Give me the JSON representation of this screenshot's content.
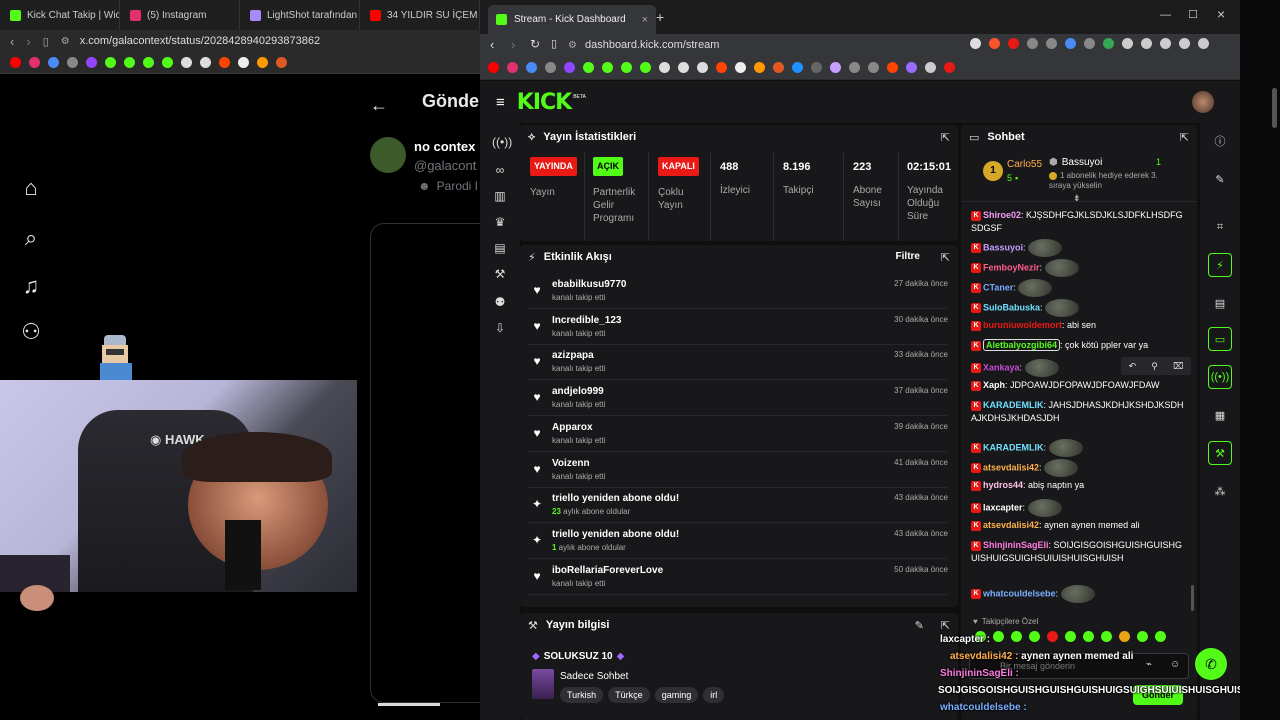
{
  "bg_browser": {
    "tabs": [
      {
        "label": "Kick Chat Takip | Wich",
        "color": "#53fc18"
      },
      {
        "label": "(5) Instagram",
        "color": "#e1306c"
      },
      {
        "label": "LightShot tarafından Ekran",
        "color": "#a78bfa"
      },
      {
        "label": "34 YILDIR SU İÇEM",
        "color": "#ff0000"
      }
    ],
    "url": "x.com/galacontext/status/2028428940293873862",
    "x_page": {
      "title": "Gönde",
      "account_name": "no contex",
      "account_handle": "@galacont",
      "account_type": "Parodi I"
    }
  },
  "browser": {
    "tab_title": "Stream - Kick Dashboard",
    "url": "dashboard.kick.com/stream"
  },
  "kick": {
    "logo": "KICK",
    "logo_badge": "BETA",
    "stats_panel": {
      "title": "Yayın İstatistikleri",
      "items": [
        {
          "badge": "YAYINDA",
          "label": "Yayın",
          "badge_color": "#e91916"
        },
        {
          "badge": "AÇIK",
          "label": "Partnerlik Gelir Programı",
          "badge_color": "#53fc18"
        },
        {
          "badge": "KAPALI",
          "label": "Çoklu Yayın",
          "badge_color": "#e91916"
        },
        {
          "value": "488",
          "label": "İzleyici"
        },
        {
          "value": "8.196",
          "label": "Takipçi"
        },
        {
          "value": "223",
          "label": "Abone Sayısı"
        },
        {
          "value": "02:15:01",
          "label": "Yayında Olduğu Süre"
        }
      ]
    },
    "activity_panel": {
      "title": "Etkinlik Akışı",
      "filter_label": "Filtre",
      "items": [
        {
          "icon": "heart-icon",
          "name": "ebabilkusu9770",
          "sub": "kanalı takip etti",
          "time": "27 dakika önce"
        },
        {
          "icon": "heart-icon",
          "name": "Incredible_123",
          "sub": "kanalı takip etti",
          "time": "30 dakika önce"
        },
        {
          "icon": "heart-icon",
          "name": "azizpapa",
          "sub": "kanalı takip etti",
          "time": "33 dakika önce"
        },
        {
          "icon": "heart-icon",
          "name": "andjelo999",
          "sub": "kanalı takip etti",
          "time": "37 dakika önce"
        },
        {
          "icon": "heart-icon",
          "name": "Apparox",
          "sub": "kanalı takip etti",
          "time": "39 dakika önce"
        },
        {
          "icon": "heart-icon",
          "name": "Voizenn",
          "sub": "kanalı takip etti",
          "time": "41 dakika önce"
        },
        {
          "icon": "sparkle-icon",
          "name": "triello yeniden abone oldu!",
          "sub_num": "23",
          "sub": "aylık abone oldular",
          "time": "43 dakika önce"
        },
        {
          "icon": "sparkle-icon",
          "name": "triello yeniden abone oldu!",
          "sub_num": "1",
          "sub": "aylık abone oldular",
          "time": "43 dakika önce"
        },
        {
          "icon": "heart-icon",
          "name": "iboRellariaForeverLove",
          "sub": "kanalı takip etti",
          "time": "50 dakika önce"
        }
      ]
    },
    "stream_info_panel": {
      "title": "Yayın bilgisi",
      "stream_title": "SOLUKSUZ 10",
      "category": "Sadece Sohbet",
      "tags": [
        "Turkish",
        "Türkçe",
        "gaming",
        "irl"
      ]
    },
    "chat_panel": {
      "title": "Sohbet",
      "pinned_user": "Carlo55",
      "pinned_rank": "1",
      "pinned_count": "5",
      "gifter": "Bassuyoi",
      "gifter_count": "1",
      "gifter_text": "1 abonelik hediye ederek 3. sıraya yükselin",
      "messages": [
        {
          "user": "Shiroe02",
          "color": "#f39cf6",
          "text": "KJŞSDHFGJKLSDJKLSJDFKLHSDFGSDGSF",
          "emote": false
        },
        {
          "user": "Bassuyoi",
          "color": "#c79cff",
          "text": "",
          "emote": true
        },
        {
          "user": "FemboyNezir",
          "color": "#ff5c8a",
          "text": "",
          "emote": true
        },
        {
          "user": "CTaner",
          "color": "#7aa7ff",
          "text": "",
          "emote": true
        },
        {
          "user": "SuloBabuska",
          "color": "#6fe0ff",
          "text": "",
          "emote": true
        },
        {
          "user": "buruniuwoldemort",
          "color": "#e91916",
          "text": "abi sen",
          "emote": false
        },
        {
          "user": "Aletbalyozgibi64",
          "color": "#53fc18",
          "text": "çok kötü ppler var ya",
          "emote": false
        },
        {
          "user": "Xankaya",
          "color": "#c44bd8",
          "text": "",
          "emote": true
        },
        {
          "user": "Xaph",
          "color": "#ffffff",
          "text": "JDPOAWJDFOPAWJDFOAWJFDAW",
          "emote": false
        },
        {
          "user": "KARADEMLIK",
          "color": "#6fe0ff",
          "text": "JAHSJDHASJKDHJKSHDJKSDHAJKDHSJKHDASJDH",
          "emote": false
        },
        {
          "user": "KARADEMLIK",
          "color": "#6fe0ff",
          "text": "",
          "emote": true
        },
        {
          "user": "atsevdalisi42",
          "color": "#ffb04c",
          "text": "",
          "emote": true
        },
        {
          "user": "hydros44",
          "color": "#ffc1e3",
          "text": "abiş naptın ya",
          "emote": false
        },
        {
          "user": "laxcapter",
          "color": "#ffffff",
          "text": "",
          "emote": true
        },
        {
          "user": "atsevdalisi42",
          "color": "#ffb04c",
          "text": "aynen aynen memed ali",
          "emote": false
        },
        {
          "user": "ShinjininSagEli",
          "color": "#ff7be0",
          "text": "SOIJGISGOISHGUISHGUISHGUISHUIGSUIGHSUIUISHUISGHUISH",
          "emote": false
        },
        {
          "user": "whatcouldelsebe",
          "color": "#7ab0ff",
          "text": "",
          "emote": true
        }
      ],
      "followers_only": "Takipçilere Özel",
      "input_placeholder": "Bir mesaj gönderin",
      "send_label": "Gönder"
    },
    "overlay_chat": [
      {
        "user": "laxcapter",
        "color": "#ffffff",
        "text": ""
      },
      {
        "user": "atsevdalisi42",
        "color": "#ffb04c",
        "text": "aynen aynen memed ali"
      },
      {
        "user": "ShinjininSagEli",
        "color": "#ff7be0",
        "text": ""
      },
      {
        "user": "",
        "color": "#ffffff",
        "text": "SOIJGISGOISHGUISHGUISHGUISHUIGSUIGHSUIUISHUISGHUISH"
      },
      {
        "user": "whatcouldelsebe",
        "color": "#7ab0ff",
        "text": ""
      }
    ],
    "colors": {
      "accent": "#53fc18",
      "live_red": "#e91916",
      "panel": "#18181b"
    }
  }
}
